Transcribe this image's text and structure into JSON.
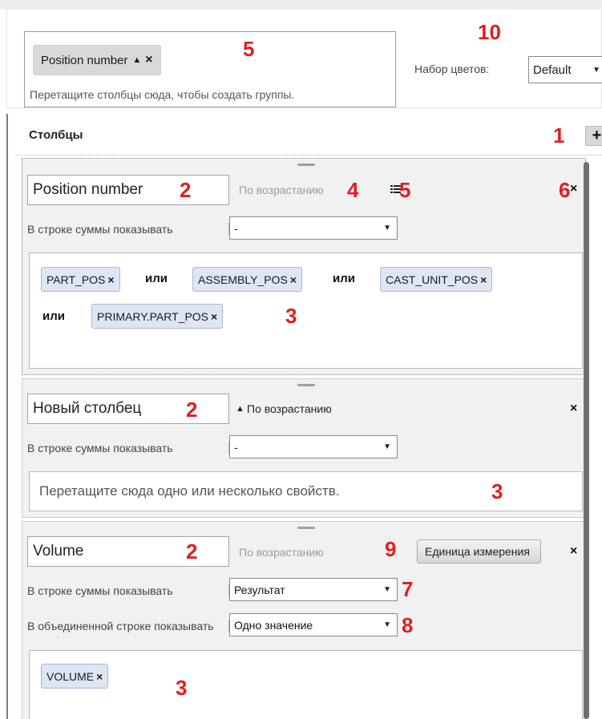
{
  "group_panel": {
    "chip_label": "Position number",
    "hint": "Перетащите столбцы сюда, чтобы создать группы.",
    "palette_label": "Набор цветов:",
    "palette_value": "Default"
  },
  "columns": {
    "title": "Столбцы",
    "add_label": "+",
    "cards": [
      {
        "name": "Position number",
        "sort_label": "По возрастанию",
        "sum_row_label": "В строке суммы показывать",
        "sum_row_value": "-",
        "properties": [
          "PART_POS",
          "ASSEMBLY_POS",
          "CAST_UNIT_POS",
          "PRIMARY.PART_POS"
        ],
        "or_label": "или"
      },
      {
        "name": "Новый столбец",
        "sort_label": "По возрастанию",
        "sum_row_label": "В строке суммы показывать",
        "sum_row_value": "-",
        "drop_hint": "Перетащите сюда одно или несколько свойств."
      },
      {
        "name": "Volume",
        "sort_label": "По возрастанию",
        "unit_button": "Единица измерения",
        "sum_row_label": "В строке суммы показывать",
        "sum_row_value": "Результат",
        "merged_row_label": "В объединенной строке показывать",
        "merged_row_value": "Одно значение",
        "properties": [
          "VOLUME"
        ]
      }
    ]
  },
  "markers": {
    "m1": "1",
    "m2": "2",
    "m3": "3",
    "m4": "4",
    "m5": "5",
    "m6": "6",
    "m7": "7",
    "m8": "8",
    "m9": "9",
    "m10": "10"
  },
  "icons": {
    "remove": "×",
    "sort_up": "▲",
    "dropdown": "▼",
    "sort_list": "list-icon"
  },
  "colors": {
    "marker": "#e01e1e",
    "chip_bg": "#dde6f2",
    "card_bg": "#f1f1f1"
  }
}
